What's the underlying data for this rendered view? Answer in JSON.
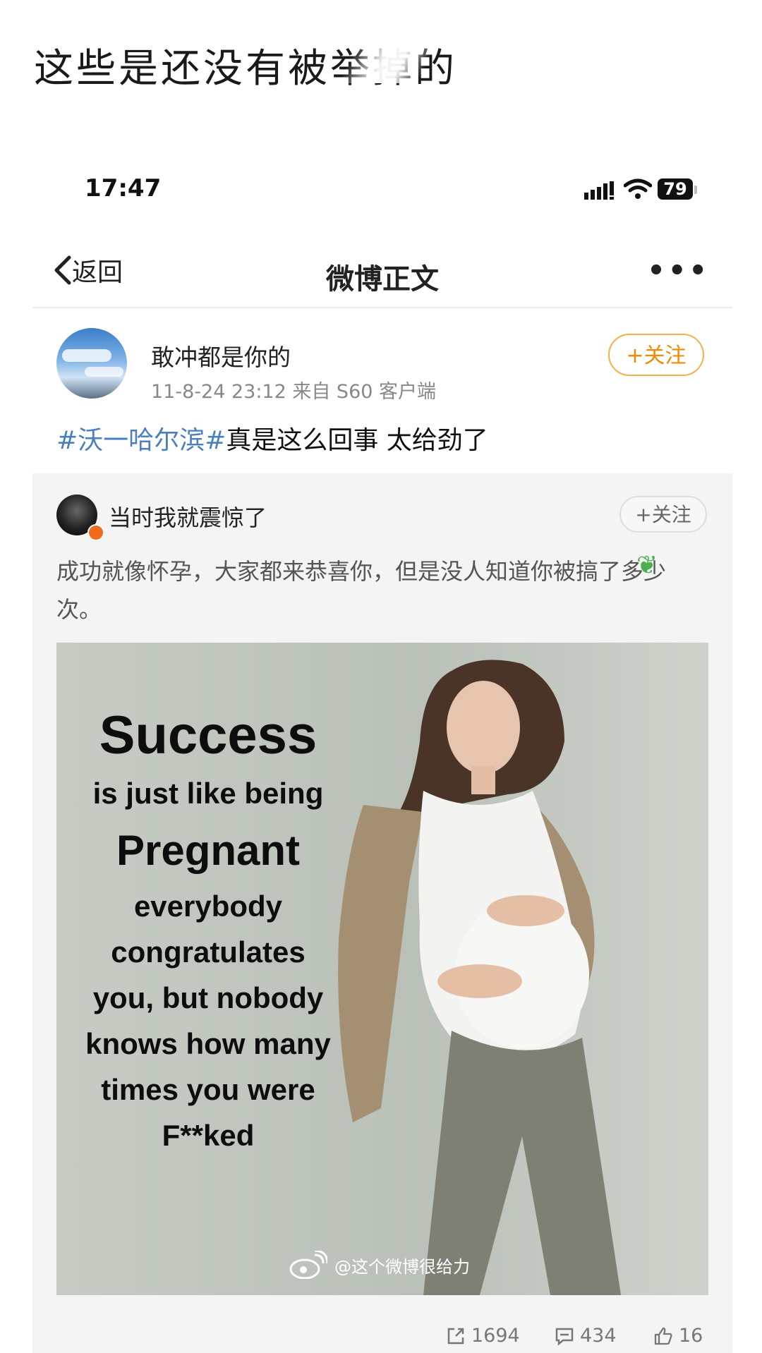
{
  "caption": "这些是还没有被举掉的",
  "status_bar": {
    "time": "17:47",
    "battery": "79"
  },
  "nav": {
    "back_label": "返回",
    "title": "微博正文"
  },
  "post": {
    "author": "敢冲都是你的",
    "meta": "11-8-24 23:12  来自 S60 客户端",
    "follow_label": "+关注",
    "topic": "#沃一哈尔滨#",
    "text": "真是这么回事   太给劲了"
  },
  "repost": {
    "author": "当时我就震惊了",
    "follow_label": "+关注",
    "text": "成功就像怀孕，大家都来恭喜你，但是没人知道你被搞了多少次。",
    "image_text": {
      "line1": "Success",
      "line2": "is just like being",
      "line3": "Pregnant",
      "line4": "everybody",
      "line5": "congratulates",
      "line6": "you, but nobody",
      "line7": "knows how many",
      "line8": "times you were",
      "line9": "F**ked"
    },
    "watermark": "@这个微博很给力",
    "stats": {
      "reposts": "1694",
      "comments": "434",
      "likes": "16"
    }
  },
  "colors": {
    "topic": "#4a7fc1",
    "follow": "#f08a00",
    "repost_bg": "#f4f4f4"
  }
}
